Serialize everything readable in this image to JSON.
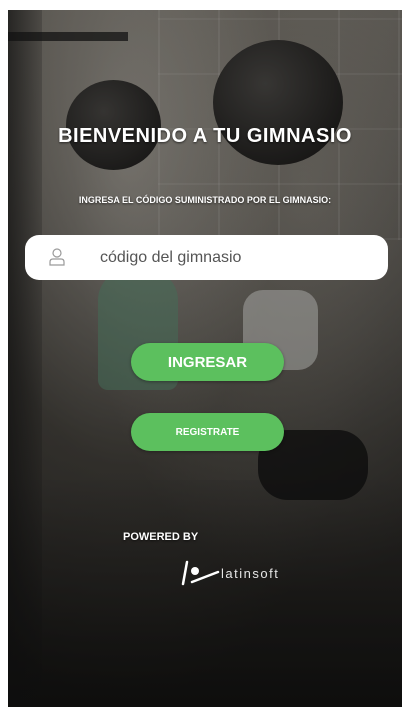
{
  "login": {
    "title": "BIENVENIDO A TU GIMNASIO",
    "subtitle": "INGRESA EL CÓDIGO SUMINISTRADO POR EL GIMNASIO:",
    "code_input": {
      "placeholder": "código del gimnasio",
      "value": "",
      "icon": "user-icon"
    },
    "primary_button": "INGRESAR",
    "secondary_button": "REGISTRATE"
  },
  "footer": {
    "powered_by": "POWERED BY",
    "brand": "latinsoft",
    "logo_icon": "latinsoft-logo"
  },
  "colors": {
    "accent_green": "#5cc05e",
    "text_white": "#ffffff",
    "input_bg": "#ffffff"
  }
}
